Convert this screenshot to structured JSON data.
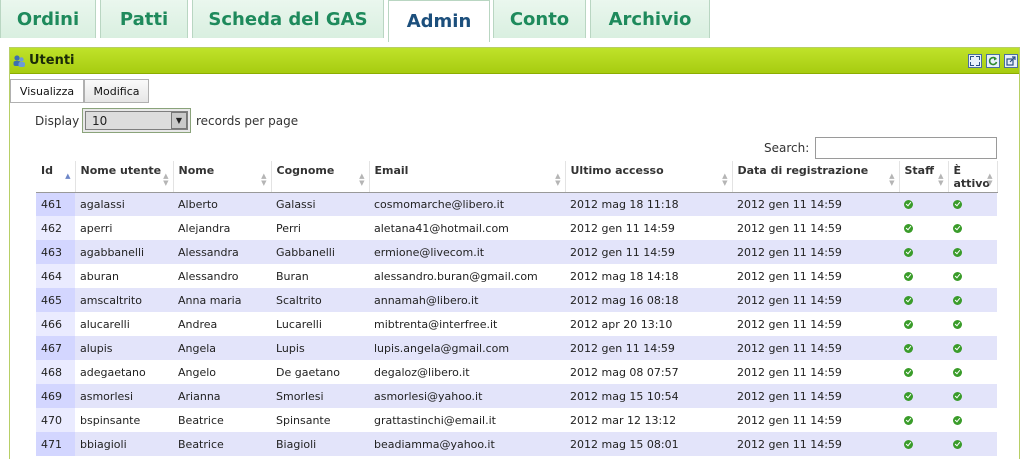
{
  "tabs": [
    {
      "label": "Ordini",
      "active": false
    },
    {
      "label": "Patti",
      "active": false
    },
    {
      "label": "Scheda del GAS",
      "active": false
    },
    {
      "label": "Admin",
      "active": true
    },
    {
      "label": "Conto",
      "active": false
    },
    {
      "label": "Archivio",
      "active": false
    }
  ],
  "panel": {
    "title": "Utenti",
    "icons": [
      "users-icon",
      "maximize-icon",
      "refresh-icon",
      "export-icon"
    ]
  },
  "subtabs": [
    {
      "label": "Visualizza",
      "active": true
    },
    {
      "label": "Modifica",
      "active": false
    }
  ],
  "length": {
    "prefix": "Display",
    "value": "10",
    "suffix": "records per page"
  },
  "search": {
    "label": "Search:",
    "value": ""
  },
  "table": {
    "columns": [
      "Id",
      "Nome utente",
      "Nome",
      "Cognome",
      "Email",
      "Ultimo accesso",
      "Data di registrazione",
      "Staff",
      "È attivo"
    ],
    "sorted_column": "Id",
    "rows": [
      [
        "461",
        "agalassi",
        "Alberto",
        "Galassi",
        "cosmomarche@libero.it",
        "2012 mag 18 11:18",
        "2012 gen 11 14:59",
        true,
        true
      ],
      [
        "462",
        "aperri",
        "Alejandra",
        "Perri",
        "aletana41@hotmail.com",
        "2012 gen 11 14:59",
        "2012 gen 11 14:59",
        true,
        true
      ],
      [
        "463",
        "agabbanelli",
        "Alessandra",
        "Gabbanelli",
        "ermione@livecom.it",
        "2012 gen 11 14:59",
        "2012 gen 11 14:59",
        true,
        true
      ],
      [
        "464",
        "aburan",
        "Alessandro",
        "Buran",
        "alessandro.buran@gmail.com",
        "2012 mag 18 14:18",
        "2012 gen 11 14:59",
        true,
        true
      ],
      [
        "465",
        "amscaltrito",
        "Anna maria",
        "Scaltrito",
        "annamah@libero.it",
        "2012 mag 16 08:18",
        "2012 gen 11 14:59",
        true,
        true
      ],
      [
        "466",
        "alucarelli",
        "Andrea",
        "Lucarelli",
        "mibtrenta@interfree.it",
        "2012 apr 20 13:10",
        "2012 gen 11 14:59",
        true,
        true
      ],
      [
        "467",
        "alupis",
        "Angela",
        "Lupis",
        "lupis.angela@gmail.com",
        "2012 gen 11 14:59",
        "2012 gen 11 14:59",
        true,
        true
      ],
      [
        "468",
        "adegaetano",
        "Angelo",
        "De gaetano",
        "degaloz@libero.it",
        "2012 mag 08 07:57",
        "2012 gen 11 14:59",
        true,
        true
      ],
      [
        "469",
        "asmorlesi",
        "Arianna",
        "Smorlesi",
        "asmorlesi@yahoo.it",
        "2012 mag 15 10:54",
        "2012 gen 11 14:59",
        true,
        true
      ],
      [
        "470",
        "bspinsante",
        "Beatrice",
        "Spinsante",
        "grattastinchi@email.it",
        "2012 mar 12 13:12",
        "2012 gen 11 14:59",
        true,
        true
      ],
      [
        "471",
        "bbiagioli",
        "Beatrice",
        "Biagioli",
        "beadiamma@yahoo.it",
        "2012 mag 15 08:01",
        "2012 gen 11 14:59",
        true,
        true
      ]
    ]
  }
}
